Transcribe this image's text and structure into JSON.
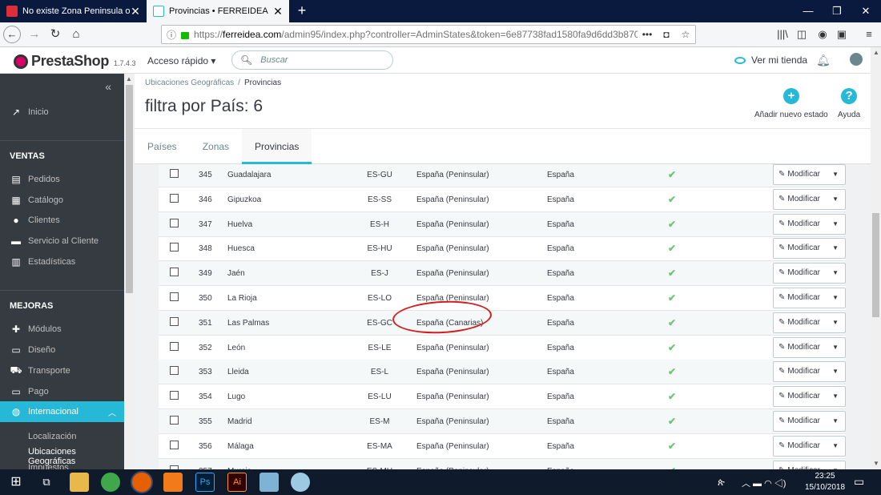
{
  "browser": {
    "tabs": [
      {
        "title": "No existe Zona Peninsula o Fue"
      },
      {
        "title": "Provincias • FERREIDEA"
      }
    ],
    "url_host": "ferreidea.com",
    "url_prefix": "https://",
    "url_rest": "/admin95/index.php?controller=AdminStates&token=6e87738fad1580fa9d6dd3b870",
    "badge_count": "0"
  },
  "header": {
    "brand": "PrestaShop",
    "version": "1.7.4.3",
    "quick_access": "Acceso rápido",
    "search_placeholder": "Buscar",
    "view_store": "Ver mi tienda"
  },
  "sidebar": {
    "items": [
      {
        "label": "Inicio",
        "icon": "trend-icon"
      }
    ],
    "section_ventas": "VENTAS",
    "ventas": [
      {
        "label": "Pedidos",
        "icon": "inbox-icon"
      },
      {
        "label": "Catálogo",
        "icon": "store-icon"
      },
      {
        "label": "Clientes",
        "icon": "account-icon"
      },
      {
        "label": "Servicio al Cliente",
        "icon": "chat-icon"
      },
      {
        "label": "Estadísticas",
        "icon": "chart-icon"
      }
    ],
    "section_mejoras": "MEJORAS",
    "mejoras": [
      {
        "label": "Módulos",
        "icon": "puzzle-icon"
      },
      {
        "label": "Diseño",
        "icon": "desktop-icon"
      },
      {
        "label": "Transporte",
        "icon": "truck-icon"
      },
      {
        "label": "Pago",
        "icon": "card-icon"
      },
      {
        "label": "Internacional",
        "icon": "globe-icon"
      }
    ],
    "sub": [
      {
        "label": "Localización"
      },
      {
        "label": "Ubicaciones Geográficas"
      },
      {
        "label": "Impuestos"
      }
    ]
  },
  "page": {
    "breadcrumb": [
      "Ubicaciones Geográficas",
      "Provincias"
    ],
    "title": "filtra por País: 6",
    "add_button": "Añadir nuevo estado",
    "help_button": "Ayuda",
    "tabs": [
      "Países",
      "Zonas",
      "Provincias"
    ]
  },
  "table": {
    "action_label": "Modificar",
    "rows": [
      {
        "id": "345",
        "name": "Guadalajara",
        "iso": "ES-GU",
        "zone": "España (Peninsular)",
        "country": "España"
      },
      {
        "id": "346",
        "name": "Gipuzkoa",
        "iso": "ES-SS",
        "zone": "España (Peninsular)",
        "country": "España"
      },
      {
        "id": "347",
        "name": "Huelva",
        "iso": "ES-H",
        "zone": "España (Peninsular)",
        "country": "España"
      },
      {
        "id": "348",
        "name": "Huesca",
        "iso": "ES-HU",
        "zone": "España (Peninsular)",
        "country": "España"
      },
      {
        "id": "349",
        "name": "Jaén",
        "iso": "ES-J",
        "zone": "España (Peninsular)",
        "country": "España"
      },
      {
        "id": "350",
        "name": "La Rioja",
        "iso": "ES-LO",
        "zone": "España (Peninsular)",
        "country": "España"
      },
      {
        "id": "351",
        "name": "Las Palmas",
        "iso": "ES-GC",
        "zone": "España (Canarias)",
        "country": "España"
      },
      {
        "id": "352",
        "name": "León",
        "iso": "ES-LE",
        "zone": "España (Peninsular)",
        "country": "España"
      },
      {
        "id": "353",
        "name": "Lleida",
        "iso": "ES-L",
        "zone": "España (Peninsular)",
        "country": "España"
      },
      {
        "id": "354",
        "name": "Lugo",
        "iso": "ES-LU",
        "zone": "España (Peninsular)",
        "country": "España"
      },
      {
        "id": "355",
        "name": "Madrid",
        "iso": "ES-M",
        "zone": "España (Peninsular)",
        "country": "España"
      },
      {
        "id": "356",
        "name": "Málaga",
        "iso": "ES-MA",
        "zone": "España (Peninsular)",
        "country": "España"
      },
      {
        "id": "357",
        "name": "Murcia",
        "iso": "ES-MU",
        "zone": "España (Peninsular)",
        "country": "España"
      }
    ]
  },
  "taskbar": {
    "time": "23:25",
    "date": "15/10/2018"
  },
  "colors": {
    "accent": "#25b9d7",
    "sidebar_bg": "#363a41",
    "annotation": "#d01f1f",
    "check": "#72c279"
  }
}
